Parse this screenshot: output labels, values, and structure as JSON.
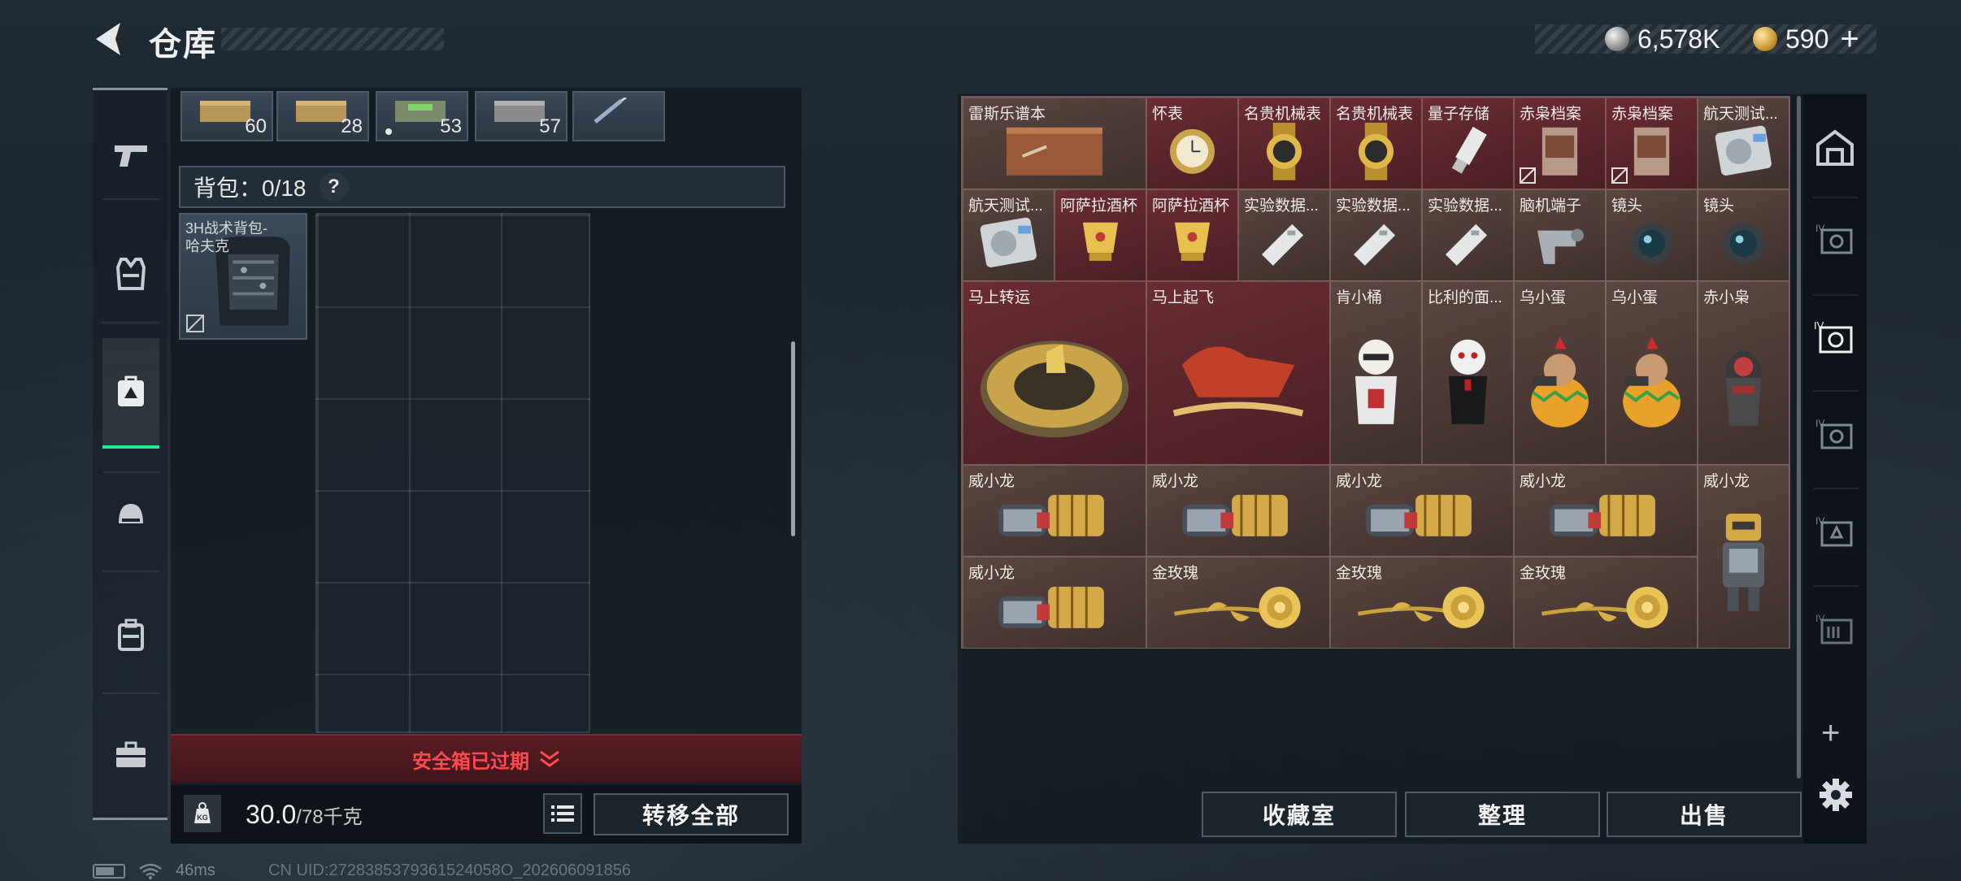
{
  "header": {
    "title": "仓库",
    "currency": [
      {
        "icon": "silver-coin-icon",
        "value": "6,578K"
      },
      {
        "icon": "gold-coin-icon",
        "value": "590"
      }
    ],
    "plus_label": "+"
  },
  "left": {
    "top_stacks": [
      {
        "icon": "ammo-box-icon",
        "qty": "60"
      },
      {
        "icon": "ammo-box-icon",
        "qty": "28"
      },
      {
        "icon": "green-ammo-box-icon",
        "qty": "53"
      },
      {
        "icon": "ammo-box-icon",
        "qty": "57"
      },
      {
        "icon": "syringe-icon",
        "qty": ""
      }
    ],
    "backpack_label": "背包：0/18",
    "help": "?",
    "backpack_item": "3H战术背包-\n哈夫克",
    "expired_notice": "安全箱已过期",
    "weight_value": "30.0",
    "weight_max": "/78千克",
    "weight_icon_label": "KG",
    "transfer_all": "转移全部"
  },
  "rail": [
    "gun-icon",
    "armor-vest-icon",
    "bag-icon",
    "helmet-icon",
    "backpack-icon",
    "toolbox-icon"
  ],
  "warehouse": {
    "items": [
      {
        "label": "雷斯乐谱本",
        "color": "brown",
        "icon": "sheet-music-book-icon"
      },
      {
        "label": "怀表",
        "color": "red",
        "icon": "pocket-watch-icon"
      },
      {
        "label": "名贵机械表",
        "color": "red",
        "icon": "gold-watch-icon"
      },
      {
        "label": "名贵机械表",
        "color": "red",
        "icon": "gold-watch-icon"
      },
      {
        "label": "量子存储",
        "color": "red",
        "icon": "usb-drive-icon"
      },
      {
        "label": "赤枭档案",
        "color": "red",
        "icon": "dossier-icon"
      },
      {
        "label": "赤枭档案",
        "color": "red",
        "icon": "dossier-icon"
      },
      {
        "label": "航天测试...",
        "color": "brown",
        "icon": "hard-drive-icon"
      },
      {
        "label": "航天测试...",
        "color": "brown",
        "icon": "hard-drive-icon"
      },
      {
        "label": "阿萨拉酒杯",
        "color": "red",
        "icon": "gold-cup-icon"
      },
      {
        "label": "阿萨拉酒杯",
        "color": "red",
        "icon": "gold-cup-icon"
      },
      {
        "label": "实验数据...",
        "color": "brown",
        "icon": "whistle-drive-icon"
      },
      {
        "label": "实验数据...",
        "color": "brown",
        "icon": "whistle-drive-icon"
      },
      {
        "label": "实验数据...",
        "color": "brown",
        "icon": "whistle-drive-icon"
      },
      {
        "label": "脑机端子",
        "color": "brown",
        "icon": "brain-interface-icon"
      },
      {
        "label": "镜头",
        "color": "brown",
        "icon": "camera-lens-icon"
      },
      {
        "label": "镜头",
        "color": "brown",
        "icon": "camera-lens-icon"
      },
      {
        "label": "马上转运",
        "color": "red",
        "icon": "gold-horse-wheel-icon"
      },
      {
        "label": "马上起飞",
        "color": "red",
        "icon": "red-horse-statue-icon"
      },
      {
        "label": "肯小桶",
        "color": "brown",
        "icon": "colonel-figure-icon"
      },
      {
        "label": "比利的面...",
        "color": "brown",
        "icon": "puppet-figure-icon"
      },
      {
        "label": "乌小蛋",
        "color": "brown",
        "icon": "egg-soldier-figure-icon"
      },
      {
        "label": "乌小蛋",
        "color": "brown",
        "icon": "egg-soldier-figure-icon"
      },
      {
        "label": "赤小枭",
        "color": "brown",
        "icon": "hooded-figure-icon"
      },
      {
        "label": "威小龙",
        "color": "brown",
        "icon": "dragon-glove-icon"
      },
      {
        "label": "威小龙",
        "color": "brown",
        "icon": "dragon-glove-icon"
      },
      {
        "label": "威小龙",
        "color": "brown",
        "icon": "dragon-glove-icon"
      },
      {
        "label": "威小龙",
        "color": "brown",
        "icon": "dragon-glove-icon"
      },
      {
        "label": "威小龙",
        "color": "brown",
        "icon": "robot-figure-icon"
      },
      {
        "label": "威小龙",
        "color": "brown",
        "icon": "dragon-glove-icon"
      },
      {
        "label": "金玫瑰",
        "color": "brown",
        "icon": "gold-rose-icon"
      },
      {
        "label": "金玫瑰",
        "color": "brown",
        "icon": "gold-rose-icon"
      },
      {
        "label": "金玫瑰",
        "color": "brown",
        "icon": "gold-rose-icon"
      }
    ],
    "buttons": {
      "collection": "收藏室",
      "sort": "整理",
      "sell": "出售"
    }
  },
  "right_rail": {
    "tabs": [
      "vault-icon",
      "storage-tab-icon",
      "storage-tab-icon",
      "storage-tab-icon",
      "storage-tab-icon",
      "storage-tab-icon"
    ],
    "plus": "+"
  },
  "status": {
    "ping": "46ms",
    "uid": "CN UID:2728385379361524058O_202606091856"
  },
  "colors": {
    "accent": "#2fe08f",
    "danger": "#ff4a50",
    "red_slot": "#6a2c33",
    "brown_slot": "#5a4540"
  }
}
